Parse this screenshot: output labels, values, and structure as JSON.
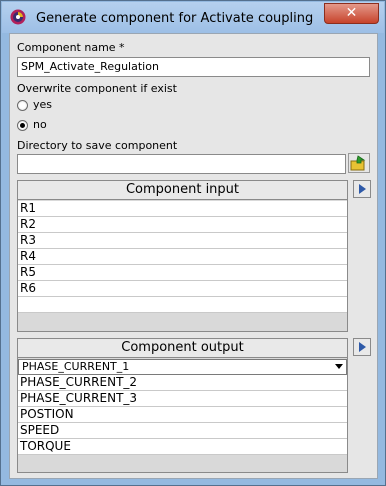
{
  "window": {
    "title": "Generate component for Activate coupling",
    "close_label": "✕",
    "app_icon": "scilab-icon"
  },
  "form": {
    "component_name_label": "Component name *",
    "component_name_value": "SPM_Activate_Regulation",
    "overwrite_label": "Overwrite component if exist",
    "overwrite_options": [
      {
        "label": "yes",
        "checked": false
      },
      {
        "label": "no",
        "checked": true
      }
    ],
    "directory_label": "Directory to save component",
    "directory_value": ""
  },
  "input_panel": {
    "header": "Component input",
    "rows": [
      "R1",
      "R2",
      "R3",
      "R4",
      "R5",
      "R6"
    ]
  },
  "output_panel": {
    "header": "Component output",
    "selected": "PHASE_CURRENT_1",
    "rows": [
      "PHASE_CURRENT_2",
      "PHASE_CURRENT_3",
      "POSTION",
      "SPEED",
      "TORQUE"
    ]
  }
}
